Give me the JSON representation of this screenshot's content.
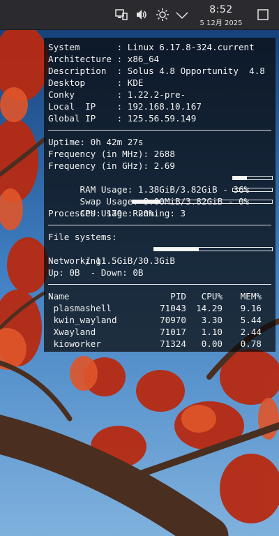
{
  "panel": {
    "time": "8:52",
    "date": "5 12月 2025",
    "icons": [
      "network-icon",
      "volume-icon",
      "brightness-icon",
      "tray-expand-chevron-icon",
      "show-desktop-icon"
    ]
  },
  "conky": {
    "system": [
      {
        "key": "System      ",
        "value": "Linux 6.17.8-324.current"
      },
      {
        "key": "Architecture",
        "value": "x86_64"
      },
      {
        "key": "Description ",
        "value": "Solus 4.8 Opportunity  4.8"
      },
      {
        "key": "Desktop     ",
        "value": "KDE"
      },
      {
        "key": "Conky       ",
        "value": "1.22.2-pre-"
      },
      {
        "key": "Local  IP   ",
        "value": "192.168.10.167"
      },
      {
        "key": "Global IP   ",
        "value": "125.56.59.149"
      }
    ],
    "stats": {
      "uptime": "Uptime: 0h 42m 27s",
      "freq_mhz": "Frequency (in MHz): 2688",
      "freq_ghz": "Frequency (in GHz): 2.69",
      "ram": "RAM Usage: 1.38GiB/3.82GiB - 36%",
      "ram_percent": 36,
      "swap": "Swap Usage: 8.00MiB/3.82GiB - 0%",
      "swap_percent": 0,
      "cpu": "CPU Usage: 20%",
      "cpu_percent": 20,
      "processes": "Processes: 179  Running: 3"
    },
    "fs": {
      "title": "File systems:",
      "root": " / 11.5GiB/30.3GiB",
      "root_percent": 38,
      "networking": "Networking:",
      "updown": "Up: 0B  - Down: 0B"
    },
    "process_table": {
      "headers": [
        "Name",
        "PID",
        "CPU%",
        "MEM%"
      ],
      "rows": [
        {
          "name": " plasmashell",
          "pid": "71043",
          "cpu": "14.29",
          "mem": "9.16"
        },
        {
          "name": " kwin_wayland",
          "pid": "70970",
          "cpu": "3.30",
          "mem": "5.44"
        },
        {
          "name": " Xwayland",
          "pid": "71017",
          "cpu": "1.10",
          "mem": "2.44"
        },
        {
          "name": " kioworker",
          "pid": "71324",
          "cpu": "0.00",
          "mem": "0.78"
        }
      ]
    }
  }
}
